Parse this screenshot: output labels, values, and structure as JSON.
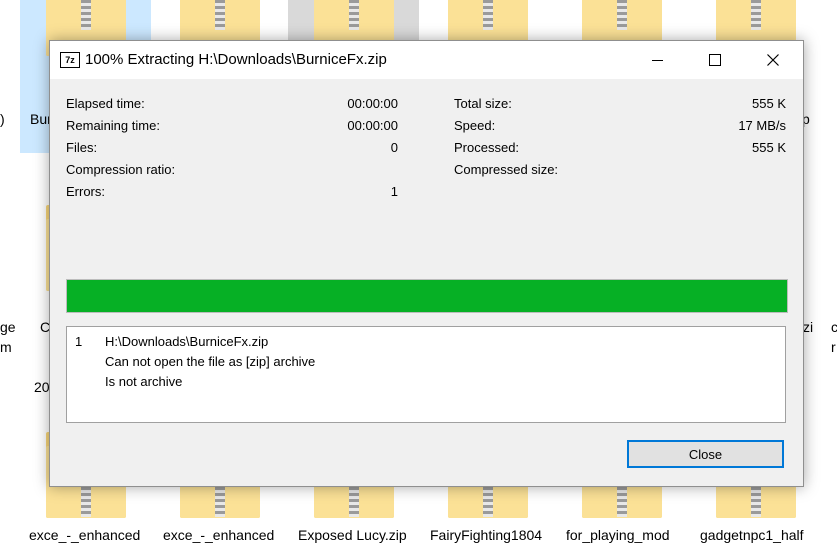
{
  "desktop": {
    "labels": {
      "top_partial_1": "Bur",
      "top_partial_2": "p",
      "left_edge_1": ")",
      "mid_left_1": "ge",
      "mid_left_2": "m",
      "mid_left_3": "C",
      "mid_left_4": "20",
      "mid_right_1": "zi",
      "mid_right_2": "c",
      "mid_right_3": "r",
      "bottom": [
        "exce_-_enhanced",
        "exce_-_enhanced",
        "Exposed Lucy.zip",
        "FairyFighting1804",
        "for_playing_mod",
        "gadgetnpc1_half"
      ]
    }
  },
  "dialog": {
    "app_icon": "7z",
    "title": "100% Extracting H:\\Downloads\\BurniceFx.zip",
    "left_stats": [
      {
        "label": "Elapsed time:",
        "value": "00:00:00"
      },
      {
        "label": "Remaining time:",
        "value": "00:00:00"
      },
      {
        "label": "Files:",
        "value": "0"
      },
      {
        "label": "Compression ratio:",
        "value": ""
      },
      {
        "label": "Errors:",
        "value": "1"
      }
    ],
    "right_stats": [
      {
        "label": "Total size:",
        "value": "555 K"
      },
      {
        "label": "Speed:",
        "value": "17 MB/s"
      },
      {
        "label": "Processed:",
        "value": "555 K"
      },
      {
        "label": "Compressed size:",
        "value": ""
      }
    ],
    "progress_percent": 100,
    "progress_color": "#06b025",
    "messages": {
      "number": "1",
      "lines": [
        "H:\\Downloads\\BurniceFx.zip",
        "Can not open the file as [zip] archive",
        "Is not archive"
      ]
    },
    "close_label": "Close"
  }
}
